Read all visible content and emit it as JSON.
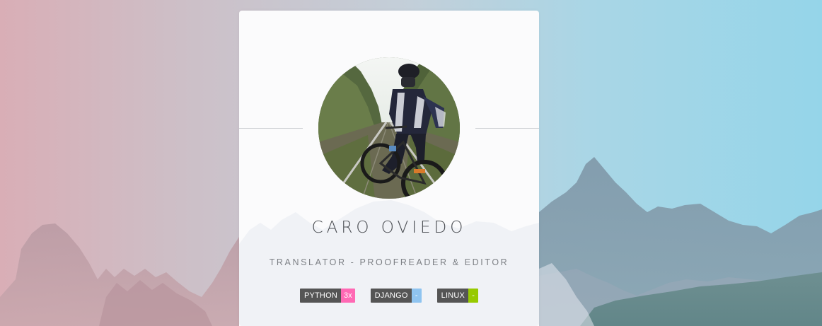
{
  "profile": {
    "name": "CARO OVIEDO",
    "role": "TRANSLATOR - PROOFREADER & EDITOR"
  },
  "badges": [
    {
      "label": "PYTHON",
      "value": "3x",
      "color": "#ff69b4"
    },
    {
      "label": "DJANGO",
      "value": "-",
      "color": "#8fc4f0"
    },
    {
      "label": "LINUX",
      "value": "-",
      "color": "#97ca00"
    }
  ],
  "colors": {
    "card_background": "#fbfbfc",
    "badge_label_background": "#555555"
  }
}
